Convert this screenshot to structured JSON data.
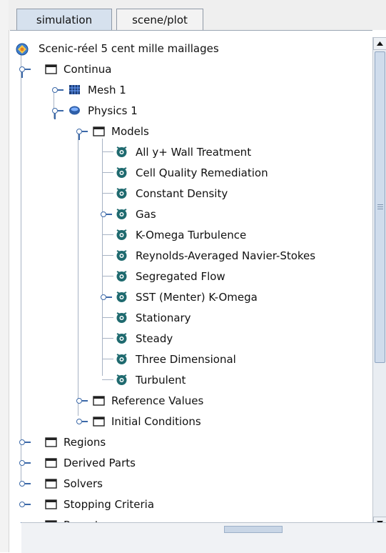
{
  "tabs": [
    {
      "label": "simulation",
      "active": true
    },
    {
      "label": "scene/plot",
      "active": false
    }
  ],
  "tree": {
    "root": "Scenic-réel 5 cent mille maillages",
    "continua": "Continua",
    "mesh": "Mesh 1",
    "physics": "Physics 1",
    "models_folder": "Models",
    "models": [
      "All y+ Wall Treatment",
      "Cell Quality Remediation",
      "Constant Density",
      "Gas",
      "K-Omega Turbulence",
      "Reynolds-Averaged Navier-Stokes",
      "Segregated Flow",
      "SST (Menter) K-Omega",
      "Stationary",
      "Steady",
      "Three Dimensional",
      "Turbulent"
    ],
    "physics_children": [
      "Reference Values",
      "Initial Conditions"
    ],
    "top_level": [
      "Regions",
      "Derived Parts",
      "Solvers",
      "Stopping Criteria",
      "Reports"
    ]
  },
  "colors": {
    "tab_active": "#d6e1ee",
    "tree_connector": "#a7b3c4",
    "toggle": "#3b68a8",
    "model_icon": "#1f6a6f",
    "physics_icon": "#2f5fa8"
  }
}
